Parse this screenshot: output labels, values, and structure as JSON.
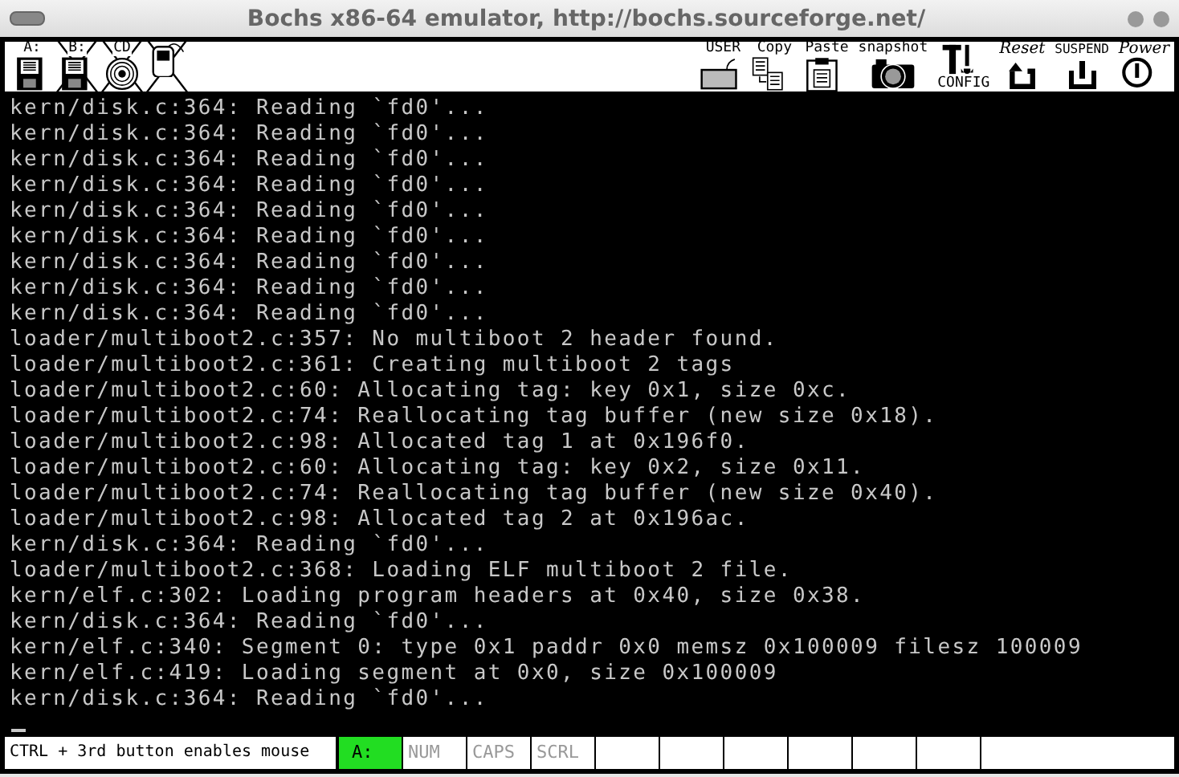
{
  "window": {
    "title": "Bochs x86-64 emulator, http://bochs.sourceforge.net/"
  },
  "toolbar": {
    "left": [
      {
        "kind": "floppy",
        "label": "A:",
        "disabled": false
      },
      {
        "kind": "floppy",
        "label": "B:",
        "disabled": true
      },
      {
        "kind": "cdrom",
        "label": "CD",
        "disabled": true
      },
      {
        "kind": "mouse",
        "disabled": true
      }
    ],
    "right": [
      {
        "kind": "user",
        "label": "USER"
      },
      {
        "kind": "copy",
        "label": "Copy"
      },
      {
        "kind": "paste",
        "label": "Paste"
      },
      {
        "kind": "snapshot",
        "label": "snapshot"
      },
      {
        "kind": "config",
        "label": "CONFIG"
      },
      {
        "kind": "reset",
        "label": "Reset"
      },
      {
        "kind": "suspend",
        "label": "SUSPEND"
      },
      {
        "kind": "power",
        "label": "Power"
      }
    ]
  },
  "console": {
    "lines": [
      "kern/disk.c:364: Reading `fd0'...",
      "kern/disk.c:364: Reading `fd0'...",
      "kern/disk.c:364: Reading `fd0'...",
      "kern/disk.c:364: Reading `fd0'...",
      "kern/disk.c:364: Reading `fd0'...",
      "kern/disk.c:364: Reading `fd0'...",
      "kern/disk.c:364: Reading `fd0'...",
      "kern/disk.c:364: Reading `fd0'...",
      "kern/disk.c:364: Reading `fd0'...",
      "loader/multiboot2.c:357: No multiboot 2 header found.",
      "loader/multiboot2.c:361: Creating multiboot 2 tags",
      "loader/multiboot2.c:60: Allocating tag: key 0x1, size 0xc.",
      "loader/multiboot2.c:74: Reallocating tag buffer (new size 0x18).",
      "loader/multiboot2.c:98: Allocated tag 1 at 0x196f0.",
      "loader/multiboot2.c:60: Allocating tag: key 0x2, size 0x11.",
      "loader/multiboot2.c:74: Reallocating tag buffer (new size 0x40).",
      "loader/multiboot2.c:98: Allocated tag 2 at 0x196ac.",
      "kern/disk.c:364: Reading `fd0'...",
      "loader/multiboot2.c:368: Loading ELF multiboot 2 file.",
      "kern/elf.c:302: Loading program headers at 0x40, size 0x38.",
      "kern/disk.c:364: Reading `fd0'...",
      "kern/elf.c:340: Segment 0: type 0x1 paddr 0x0 memsz 0x100009 filesz 100009",
      "kern/elf.c:419: Loading segment at 0x0, size 0x100009",
      "kern/disk.c:364: Reading `fd0'..."
    ],
    "cursor": true
  },
  "status_bar": {
    "message": "CTRL + 3rd button enables mouse",
    "indicators": [
      {
        "label": "A:",
        "on": true
      },
      {
        "label": "NUM",
        "on": false
      },
      {
        "label": "CAPS",
        "on": false
      },
      {
        "label": "SCRL",
        "on": false
      }
    ]
  }
}
